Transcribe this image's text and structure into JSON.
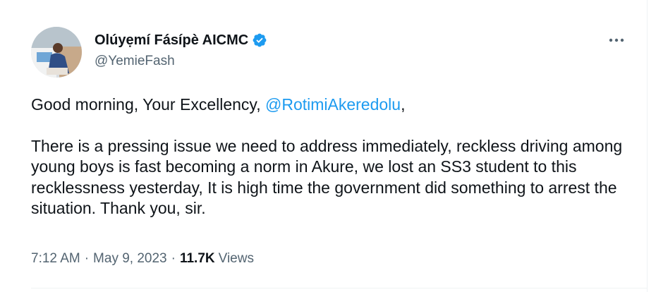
{
  "tweet": {
    "author": {
      "display_name": "Olúyẹmí Fásípè AICMC",
      "handle": "@YemieFash",
      "verified": true,
      "avatar_icon": "profile-photo"
    },
    "more_icon": "more-horizontal-icon",
    "body": {
      "greeting_prefix": "Good morning, Your Excellency, ",
      "mention": "@RotimiAkeredolu",
      "greeting_suffix": ",",
      "paragraph": "There is a pressing issue we need to address immediately, reckless driving among young boys is fast becoming a norm in Akure, we lost an SS3 student to this recklessness yesterday, It is high time the government did something to arrest the situation. Thank you, sir."
    },
    "meta": {
      "time": "7:12 AM",
      "separator": "·",
      "date": "May 9, 2023",
      "views_count": "11.7K",
      "views_label": "Views"
    }
  },
  "colors": {
    "accent": "#1d9bf0",
    "text": "#0f1419",
    "secondary": "#536471"
  }
}
